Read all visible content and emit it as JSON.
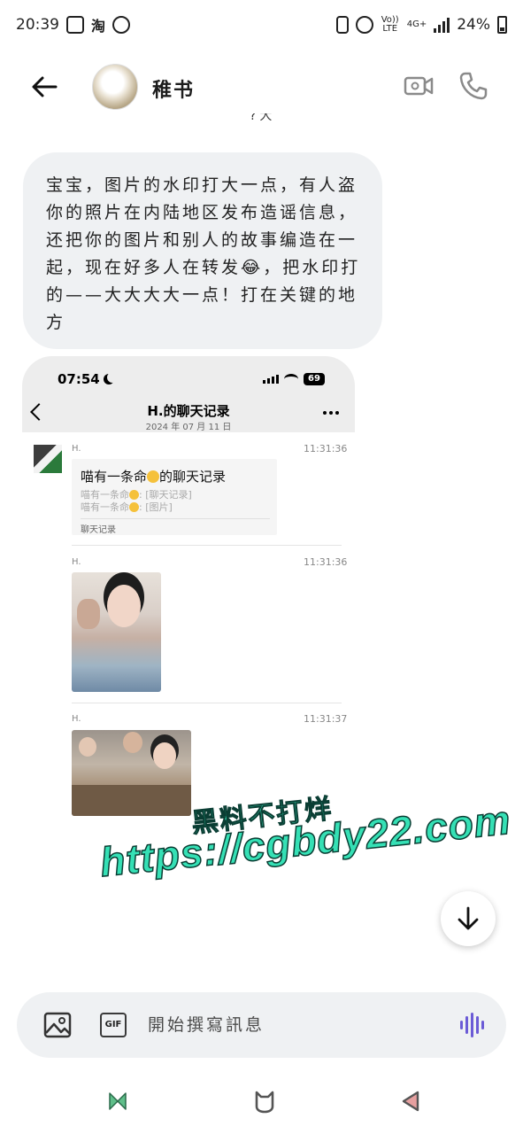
{
  "status_bar": {
    "time": "20:39",
    "app_icons": [
      "gallery-icon",
      "taobao-icon",
      "whatsapp-icon"
    ],
    "volte": "Vo)) LTE",
    "network": "4G+",
    "battery": "24%"
  },
  "header": {
    "contact_name": "稚书",
    "icons": [
      "back-arrow-icon",
      "video-call-icon",
      "phone-call-icon"
    ]
  },
  "message": {
    "cut_text": "?大",
    "text": "宝宝，图片的水印打大一点，有人盗你的照片在内陆地区发布造谣信息，还把你的图片和别人的故事编造在一起，现在好多人在转发😂，把水印打的——大大大大一点！打在关键的地方"
  },
  "screenshot": {
    "time": "07:54",
    "battery": "69",
    "title": "H.的聊天记录",
    "subtitle": "2024 年 07 月 11 日",
    "messages": [
      {
        "sender": "H.",
        "time": "11:31:36",
        "record_title": "喵有一条命",
        "record_title_suffix": "的聊天记录",
        "record_line_1_prefix": "喵有一条命",
        "record_line_1_suffix": ": [聊天记录]",
        "record_line_2_prefix": "喵有一条命",
        "record_line_2_suffix": ": [图片]",
        "record_footer": "聊天记录"
      },
      {
        "sender": "H.",
        "time": "11:31:36"
      },
      {
        "sender": "H.",
        "time": "11:31:37"
      }
    ]
  },
  "watermark": {
    "line1": "黑料不打烊",
    "line2": "https://cgbdy22.com"
  },
  "composer": {
    "placeholder": "開始撰寫訊息",
    "gif_label": "GIF"
  },
  "colors": {
    "bubble": "#eff1f3",
    "watermark": "#35e0b5",
    "voice_accent": "#6b5bd6"
  }
}
